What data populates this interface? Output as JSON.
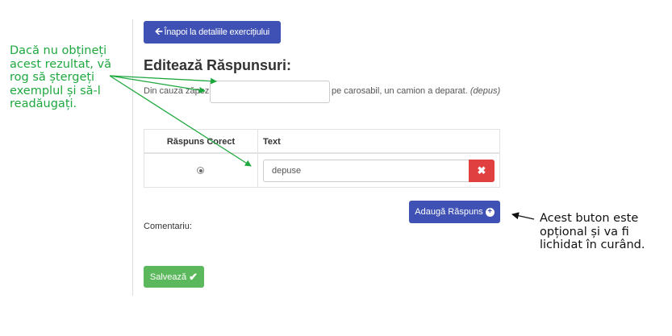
{
  "annotations": {
    "green_note": "Dacă nu obțineți acest rezultat, vă rog să ștergeți exemplul și să-l readăugați.",
    "black_note": "Acest buton este opțional și va fi lichidat în curând."
  },
  "toolbar": {
    "back_label": "Înapoi la detaliile exercițiului",
    "back_icon": "arrow-left-icon"
  },
  "page": {
    "title": "Editează Răspunsuri:"
  },
  "sentence": {
    "before_gap": "Din cauza zăpezii",
    "gap_value": "",
    "after_gap": "pe carosabil, un camion a deparat.",
    "answer_hint": "(depus)"
  },
  "answers_table": {
    "headers": {
      "correct": "Răspuns Corect",
      "text": "Text"
    },
    "rows": [
      {
        "correct_selected": true,
        "text": "depuse"
      }
    ]
  },
  "buttons": {
    "delete_icon": "times-icon",
    "add_answer_label": "Adaugă Răspuns",
    "add_icon": "plus-circle-icon",
    "save_label": "Salvează",
    "save_icon": "check-icon"
  },
  "comment": {
    "label": "Comentariu:"
  },
  "colors": {
    "primary": "#3f51b5",
    "danger": "#e04040",
    "success": "#5cb85c",
    "annotation_green": "#1fa83f",
    "annotation_black": "#111111"
  }
}
